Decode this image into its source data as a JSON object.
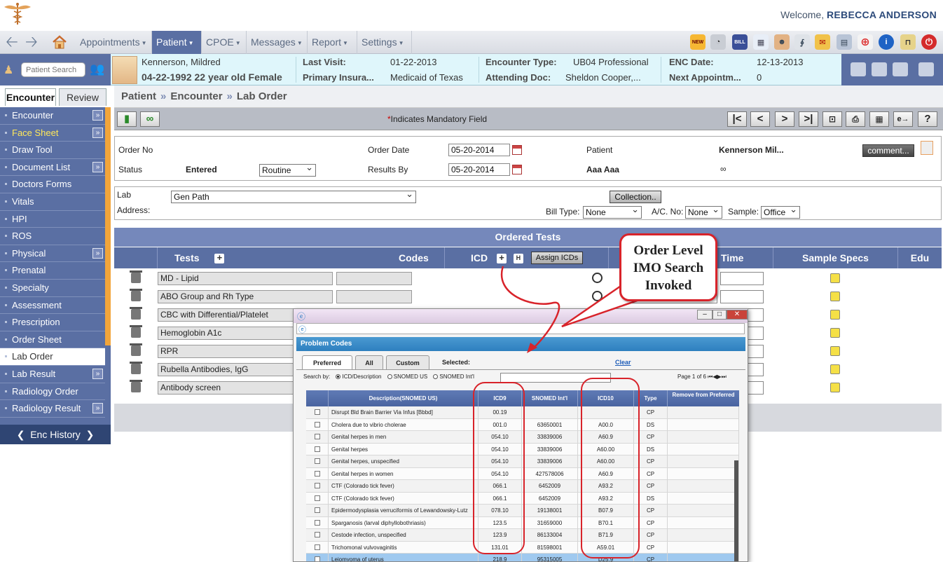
{
  "header": {
    "welcome_prefix": "Welcome,",
    "user_name": "REBECCA ANDERSON"
  },
  "menu": {
    "items": [
      {
        "label": "Appointments"
      },
      {
        "label": "Patient"
      },
      {
        "label": "CPOE"
      },
      {
        "label": "Messages"
      },
      {
        "label": "Report"
      },
      {
        "label": "Settings"
      }
    ],
    "active": "Patient"
  },
  "patient_bar": {
    "search_placeholder": "Patient Search",
    "name": "Kennerson, Mildred",
    "dob_age": "04-22-1992 22 year old Female",
    "last_visit_label": "Last Visit:",
    "last_visit": "01-22-2013",
    "primary_ins_label": "Primary Insura...",
    "primary_ins": "Medicaid of Texas",
    "enc_type_label": "Encounter Type:",
    "enc_type": "UB04 Professional",
    "attending_label": "Attending Doc:",
    "attending": "Sheldon Cooper,...",
    "enc_date_label": "ENC Date:",
    "enc_date": "12-13-2013",
    "next_appt_label": "Next Appointm...",
    "next_appt": "0"
  },
  "sidebar": {
    "tabs": [
      {
        "label": "Encounter"
      },
      {
        "label": "Review"
      }
    ],
    "items": [
      {
        "label": "Encounter",
        "expand": "»"
      },
      {
        "label": "Face Sheet",
        "expand": "»"
      },
      {
        "label": "Draw Tool",
        "expand": ""
      },
      {
        "label": "Document List",
        "expand": "»"
      },
      {
        "label": "Doctors Forms",
        "expand": ""
      },
      {
        "label": "Vitals",
        "expand": ""
      },
      {
        "label": "HPI",
        "expand": ""
      },
      {
        "label": "ROS",
        "expand": ""
      },
      {
        "label": "Physical",
        "expand": "»"
      },
      {
        "label": "Prenatal",
        "expand": ""
      },
      {
        "label": "Specialty",
        "expand": ""
      },
      {
        "label": "Assessment",
        "expand": ""
      },
      {
        "label": "Prescription",
        "expand": ""
      },
      {
        "label": "Order Sheet",
        "expand": ""
      },
      {
        "label": "Lab Order",
        "expand": ""
      },
      {
        "label": "Lab Result",
        "expand": "»"
      },
      {
        "label": "Radiology Order",
        "expand": ""
      },
      {
        "label": "Radiology Result",
        "expand": "»"
      }
    ],
    "enc_history": "Enc History"
  },
  "breadcrumb": {
    "items": [
      "Patient",
      "Encounter",
      "Lab Order"
    ],
    "sep": "»"
  },
  "toolbar": {
    "mandatory_star": "*",
    "mandatory_text": "Indicates Mandatory Field"
  },
  "order": {
    "order_no_label": "Order No",
    "order_date_label": "Order Date",
    "order_date": "05-20-2014",
    "patient_label": "Patient",
    "patient_value": "Kennerson Mil...",
    "comment_btn": "comment...",
    "status_label": "Status",
    "status_value": "Entered",
    "priority": "Routine",
    "results_by_label": "Results By",
    "results_by": "05-20-2014",
    "provider": "Aaa Aaa"
  },
  "lab": {
    "lab_label": "Lab",
    "lab_value": "Gen Path",
    "address_label": "Address:",
    "collection_btn": "Collection..",
    "bill_type_label": "Bill Type:",
    "bill_type": "None",
    "ac_no_label": "A/C. No:",
    "ac_no": "None",
    "sample_label": "Sample:",
    "sample": "Office"
  },
  "ordered_tests": {
    "title": "Ordered Tests",
    "columns": {
      "tests": "Tests",
      "codes": "Codes",
      "icd": "ICD",
      "h": "H",
      "assign": "Assign ICDs",
      "time": "Time",
      "sample_specs": "Sample Specs",
      "edu": "Edu"
    },
    "rows": [
      {
        "test": "MD - Lipid"
      },
      {
        "test": "ABO Group and Rh Type"
      },
      {
        "test": "CBC with Differential/Platelet"
      },
      {
        "test": "Hemoglobin A1c"
      },
      {
        "test": "RPR"
      },
      {
        "test": "Rubella Antibodies, IgG"
      },
      {
        "test": "Antibody screen"
      }
    ]
  },
  "popup": {
    "header": "Problem Codes",
    "tabs": [
      {
        "label": "Preferred"
      },
      {
        "label": "All"
      },
      {
        "label": "Custom"
      }
    ],
    "selected_label": "Selected:",
    "clear_label": "Clear",
    "search_by_label": "Search by:",
    "search_options": [
      "ICD/Description",
      "SNOMED US",
      "SNOMED Int'l"
    ],
    "page_info": "Page 1 of 6",
    "columns": {
      "desc": "Description(SNOMED US)",
      "icd9": "ICD9",
      "snomed": "SNOMED Int'l",
      "icd10": "ICD10",
      "type": "Type",
      "remove": "Remove from Preferred"
    },
    "rows": [
      {
        "desc": "Disrupt Bld Brain Barrier Via Infus [Bbbd]",
        "icd9": "00.19",
        "snomed": "",
        "icd10": "",
        "type": "CP"
      },
      {
        "desc": "Cholera due to vibrio cholerae",
        "icd9": "001.0",
        "snomed": "63650001",
        "icd10": "A00.0",
        "type": "DS"
      },
      {
        "desc": "Genital herpes in men",
        "icd9": "054.10",
        "snomed": "33839006",
        "icd10": "A60.9",
        "type": "CP"
      },
      {
        "desc": "Genital herpes",
        "icd9": "054.10",
        "snomed": "33839006",
        "icd10": "A60.00",
        "type": "DS"
      },
      {
        "desc": "Genital herpes, unspecified",
        "icd9": "054.10",
        "snomed": "33839006",
        "icd10": "A60.00",
        "type": "CP"
      },
      {
        "desc": "Genital herpes in women",
        "icd9": "054.10",
        "snomed": "427578006",
        "icd10": "A60.9",
        "type": "CP"
      },
      {
        "desc": "CTF (Colorado tick fever)",
        "icd9": "066.1",
        "snomed": "6452009",
        "icd10": "A93.2",
        "type": "CP"
      },
      {
        "desc": "CTF (Colorado tick fever)",
        "icd9": "066.1",
        "snomed": "6452009",
        "icd10": "A93.2",
        "type": "DS"
      },
      {
        "desc": "Epidermodysplasia verruciformis of Lewandowsky-Lutz",
        "icd9": "078.10",
        "snomed": "19138001",
        "icd10": "B07.9",
        "type": "CP"
      },
      {
        "desc": "Sparganosis (larval diphyllobothriasis)",
        "icd9": "123.5",
        "snomed": "31659000",
        "icd10": "B70.1",
        "type": "CP"
      },
      {
        "desc": "Cestode infection, unspecified",
        "icd9": "123.9",
        "snomed": "86133004",
        "icd10": "B71.9",
        "type": "CP"
      },
      {
        "desc": "Trichomonal vulvovaginitis",
        "icd9": "131.01",
        "snomed": "81598001",
        "icd10": "A59.01",
        "type": "CP"
      },
      {
        "desc": "Leiomyoma of uterus",
        "icd9": "218.9",
        "snomed": "95315005",
        "icd10": "D25.9",
        "type": "CP"
      }
    ]
  },
  "callout": {
    "lines": [
      "Order Level",
      "IMO Search",
      "Invoked"
    ]
  },
  "colors": {
    "nav_blue": "#5a6fa3",
    "accent_orange": "#f2a53b",
    "callout_red": "#d8232a",
    "popup_header": "#2e7fbf"
  }
}
